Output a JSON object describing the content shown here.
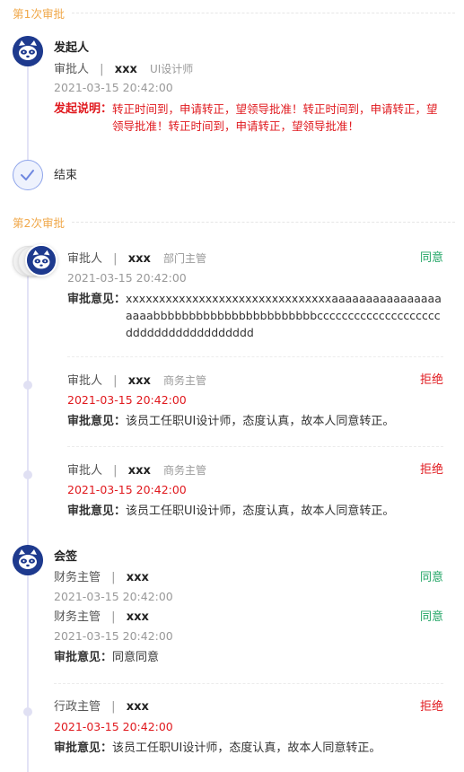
{
  "rounds": [
    {
      "title": "第1次审批"
    },
    {
      "title": "第2次审批"
    }
  ],
  "initiator": {
    "title": "发起人",
    "role": "审批人",
    "sep": "|",
    "name": "xxx",
    "position": "UI设计师",
    "time": "2021-03-15 20:42:00",
    "desc_label": "发起说明：",
    "desc_text": "转正时间到，申请转正，望领导批准！转正时间到，申请转正，望领导批准！转正时间到，申请转正，望领导批准！"
  },
  "end": {
    "label": "结束"
  },
  "round2": {
    "approvals": [
      {
        "role": "审批人",
        "sep": "|",
        "name": "xxx",
        "position": "部门主管",
        "time": "2021-03-15 20:42:00",
        "status": "同意",
        "status_color": "#22a565",
        "opinion_label": "审批意见：",
        "opinion": "xxxxxxxxxxxxxxxxxxxxxxxxxxxxxxxaaaaaaaaaaaaaaaaaaaabbbbbbbbbbbbbbbbbbbbbbbccccccccccccccccccccdddddddddddddddddd"
      },
      {
        "role": "审批人",
        "sep": "|",
        "name": "xxx",
        "position": "商务主管",
        "time": "2021-03-15 20:42:00",
        "status": "拒绝",
        "status_color": "#e0191e",
        "opinion_label": "审批意见：",
        "opinion": "该员工任职UI设计师，态度认真，故本人同意转正。"
      },
      {
        "role": "审批人",
        "sep": "|",
        "name": "xxx",
        "position": "商务主管",
        "time": "2021-03-15 20:42:00",
        "status": "拒绝",
        "status_color": "#e0191e",
        "opinion_label": "审批意见：",
        "opinion": "该员工任职UI设计师，态度认真，故本人同意转正。"
      }
    ],
    "countersign": {
      "title": "会签",
      "entries": [
        {
          "role": "财务主管",
          "sep": "|",
          "name": "xxx",
          "time": "2021-03-15 20:42:00",
          "status": "同意"
        },
        {
          "role": "财务主管",
          "sep": "|",
          "name": "xxx",
          "time": "2021-03-15 20:42:00",
          "status": "同意"
        }
      ],
      "opinion_label": "审批意见：",
      "opinion": "同意同意"
    },
    "admin": {
      "role": "行政主管",
      "sep": "|",
      "name": "xxx",
      "time": "2021-03-15 20:42:00",
      "status": "拒绝",
      "opinion_label": "审批意见：",
      "opinion": "该员工任职UI设计师，态度认真，故本人同意转正。"
    }
  },
  "colors": {
    "accent_orange": "#f0a84a",
    "approve_green": "#22a565",
    "reject_red": "#e0191e",
    "avatar_blue": "#1e3a8e"
  }
}
